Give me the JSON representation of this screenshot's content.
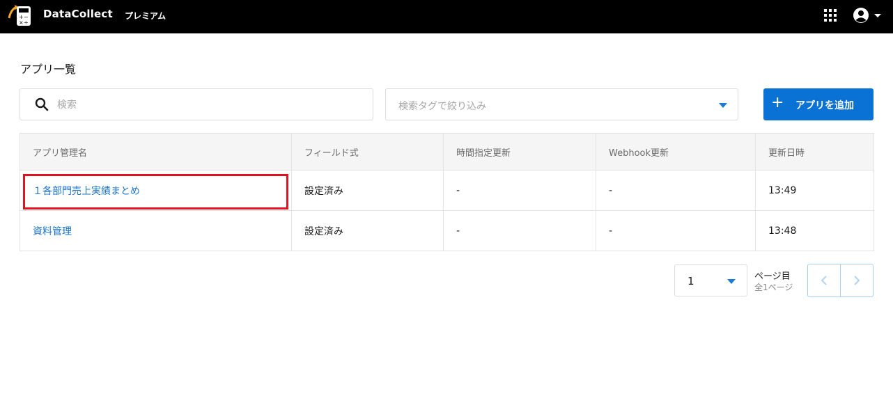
{
  "header": {
    "brand": "DataCollect",
    "plan": "プレミアム",
    "icons": [
      "calculator-logo-icon",
      "apps-grid-icon",
      "account-icon",
      "caret-down-icon"
    ]
  },
  "page": {
    "title": "アプリ一覧"
  },
  "toolbar": {
    "search_placeholder": "検索",
    "tag_filter_placeholder": "検索タグで絞り込み",
    "add_button_plus": "+",
    "add_button_label": "アプリを追加"
  },
  "table": {
    "columns": [
      "アプリ管理名",
      "フィールド式",
      "時間指定更新",
      "Webhook更新",
      "更新日時"
    ],
    "rows": [
      {
        "name": "１各部門売上実績まとめ",
        "field": "設定済み",
        "schedule": "-",
        "webhook": "-",
        "updated": "13:49"
      },
      {
        "name": "資料管理",
        "field": "設定済み",
        "schedule": "-",
        "webhook": "-",
        "updated": "13:48"
      }
    ]
  },
  "pagination": {
    "current_page": "1",
    "suffix": "ページ目",
    "total": "全1ページ"
  },
  "colors": {
    "accent": "#0a72d4",
    "link": "#1a73c8",
    "highlight": "#e0141f",
    "topbar": "#000000"
  }
}
